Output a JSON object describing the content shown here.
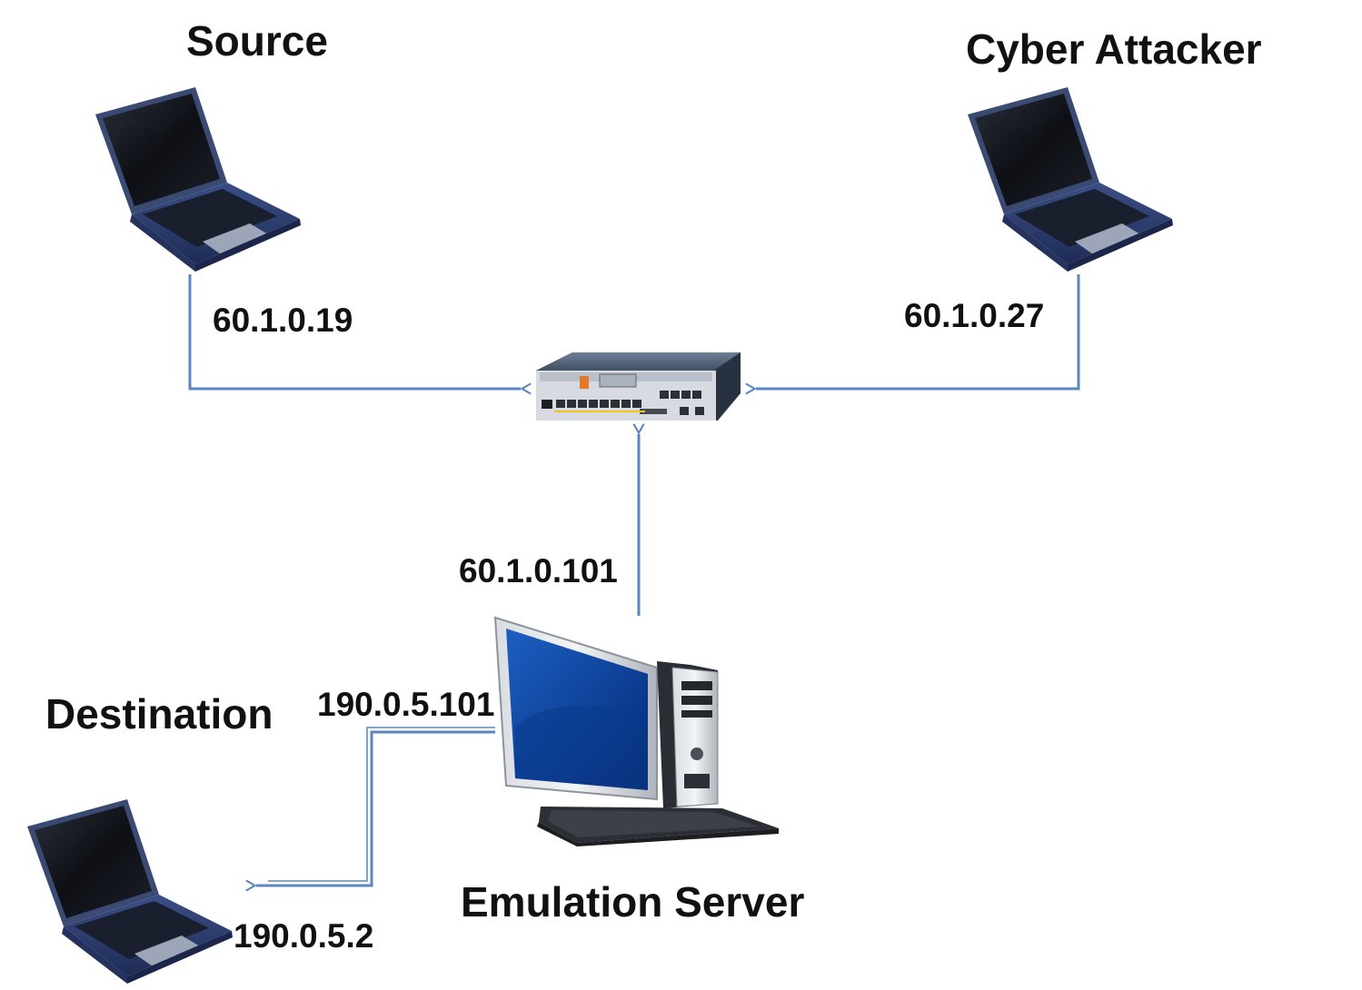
{
  "nodes": {
    "source": {
      "title": "Source",
      "ip": "60.1.0.19",
      "icon": "laptop-icon"
    },
    "attacker": {
      "title": "Cyber Attacker",
      "ip": "60.1.0.27",
      "icon": "laptop-icon"
    },
    "router": {
      "icon": "router-icon"
    },
    "server": {
      "title": "Emulation Server",
      "ip_router_side": "60.1.0.101",
      "ip_dest_side": "190.0.5.101",
      "icon": "desktop-computer-icon"
    },
    "destination": {
      "title": "Destination",
      "ip": "190.0.5.2",
      "icon": "laptop-icon"
    }
  },
  "colors": {
    "link": "#5b86c0",
    "text": "#111111"
  }
}
